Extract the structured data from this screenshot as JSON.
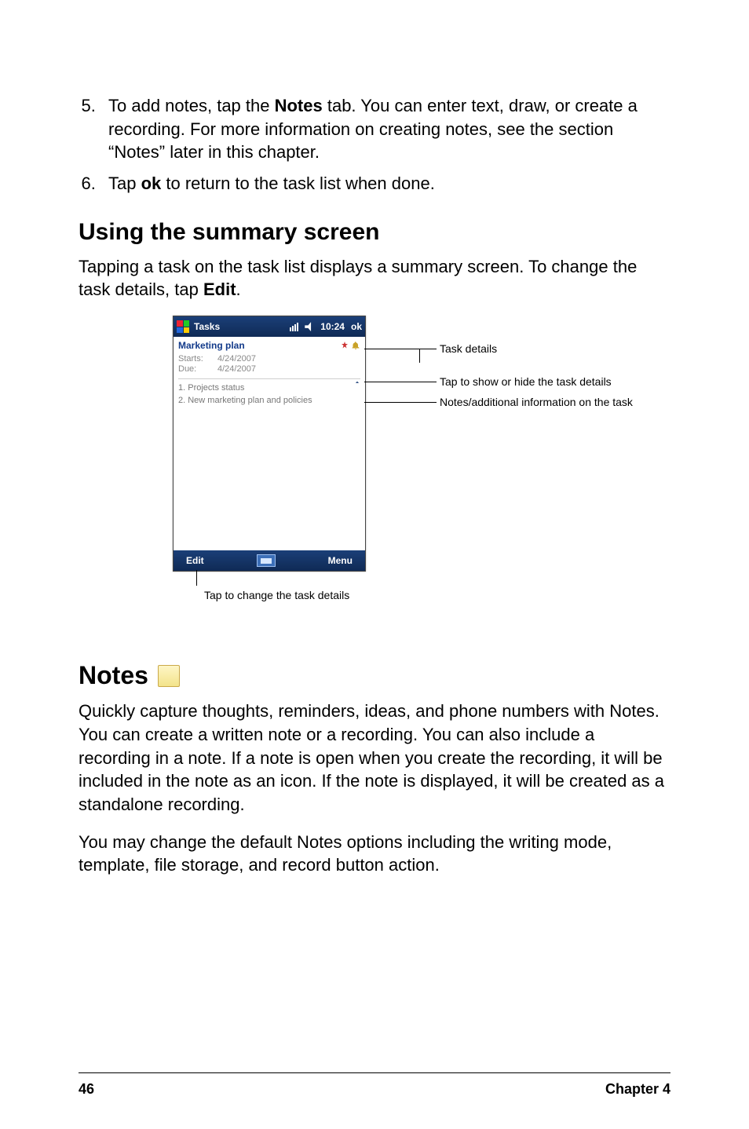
{
  "list": {
    "item5": {
      "run1": "To add notes, tap the ",
      "bold1": "Notes",
      "run2": " tab. You can enter text, draw, or create a recording. For more information on creating notes, see the section “Notes” later in this chapter."
    },
    "item6": {
      "run1": "Tap ",
      "bold1": "ok",
      "run2": " to return to the task list when done."
    }
  },
  "section1": {
    "heading": "Using the summary screen",
    "para_run1": "Tapping a task on the task list displays a summary screen. To change the task details, tap ",
    "para_bold": "Edit",
    "para_run2": "."
  },
  "device": {
    "titlebar": {
      "app": "Tasks",
      "time": "10:24",
      "ok": "ok"
    },
    "task_title": "Marketing plan",
    "meta": {
      "starts_label": "Starts:",
      "starts_value": "4/24/2007",
      "due_label": "Due:",
      "due_value": "4/24/2007"
    },
    "notes_line1": "1. Projects status",
    "notes_line2": "2. New marketing plan and policies",
    "bottombar": {
      "left": "Edit",
      "right": "Menu"
    }
  },
  "annotations": {
    "task_details": "Task details",
    "tap_toggle": "Tap to show or hide the task details",
    "notes_info": "Notes/additional information on the task",
    "caption": "Tap to change the task details"
  },
  "section2": {
    "heading": "Notes",
    "para1": "Quickly capture thoughts, reminders, ideas, and phone numbers with Notes. You can create a written note or a recording. You can also include a recording in a note. If a note is open when you create the recording, it will be included in the note as an icon. If the note is displayed, it will be created as a standalone recording.",
    "para2": "You may change the default Notes options including the writing mode, template, file storage, and record button action."
  },
  "footer": {
    "page": "46",
    "chapter": "Chapter 4"
  }
}
